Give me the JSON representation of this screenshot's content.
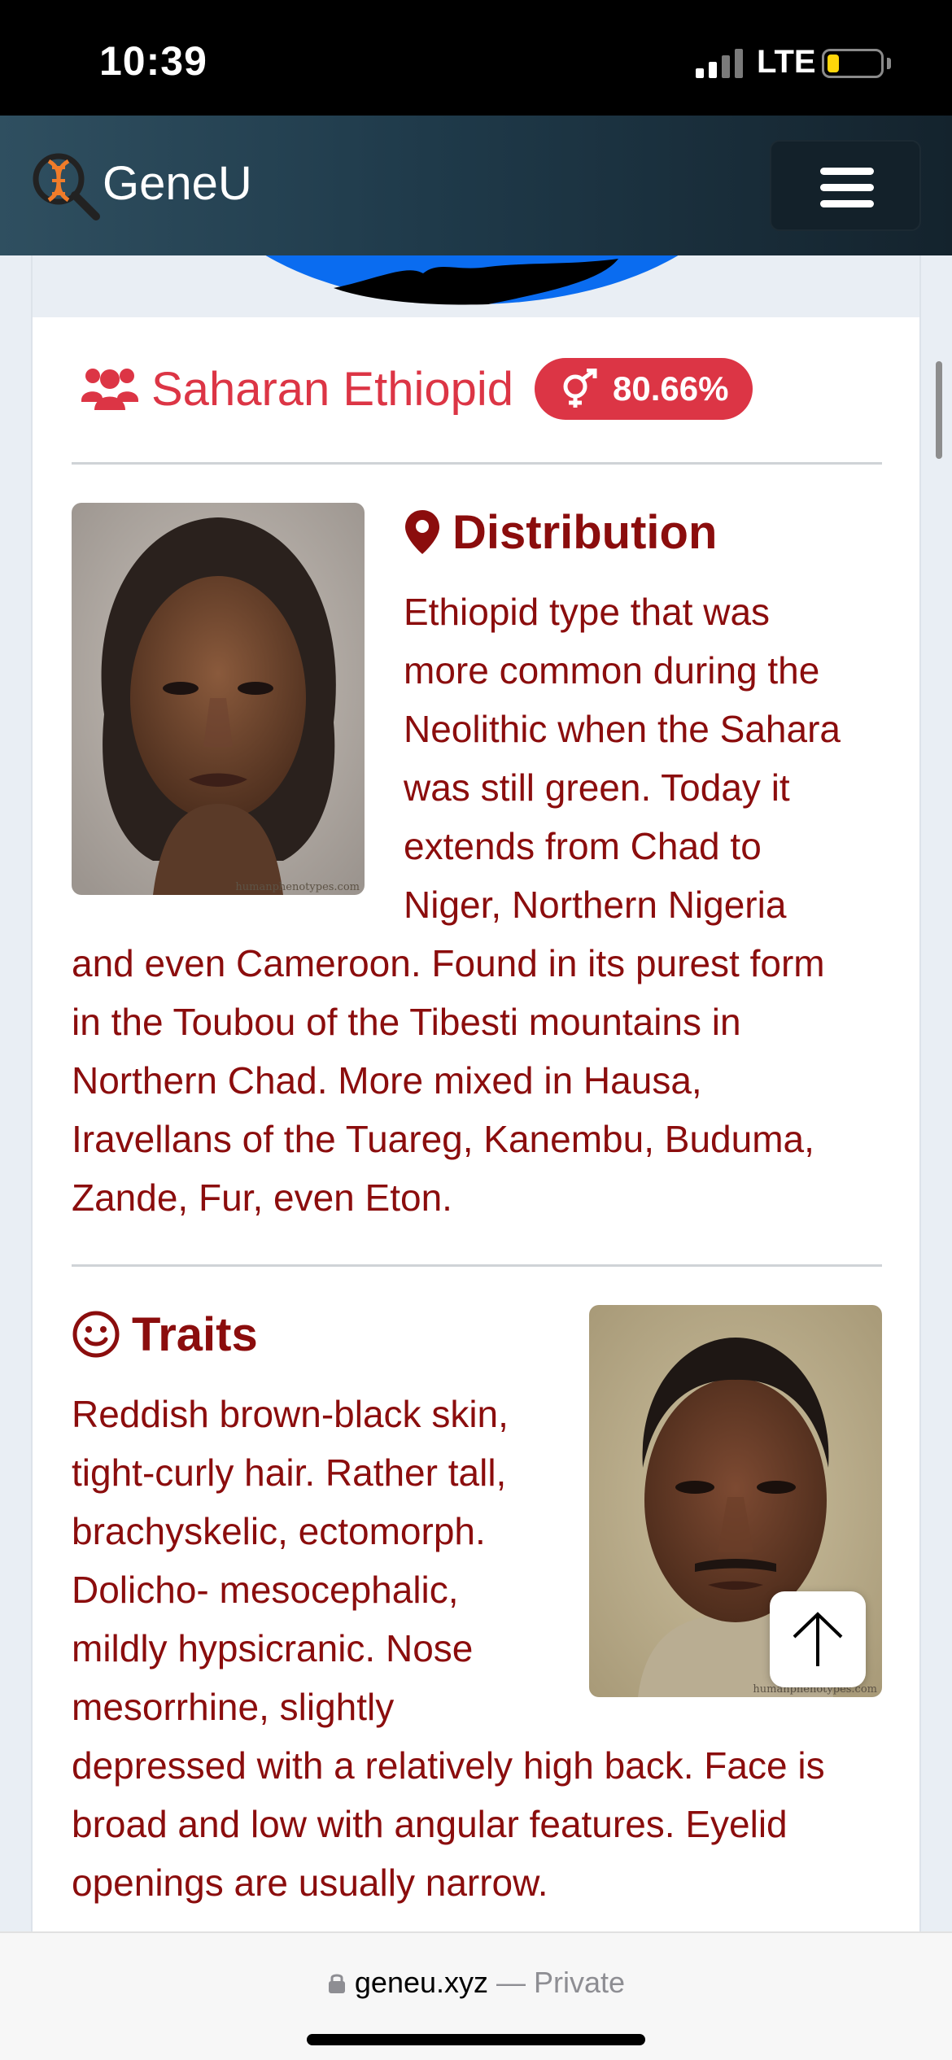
{
  "status_bar": {
    "time": "10:39",
    "network": "LTE"
  },
  "navbar": {
    "brand": "GeneU",
    "logo_icon": "dna-magnifier-icon",
    "menu_icon": "hamburger-icon"
  },
  "card": {
    "title": "Saharan Ethiopid",
    "title_icon": "users-icon",
    "badge_icon": "gender-icon",
    "badge_value": "80.66%",
    "distribution": {
      "heading": "Distribution",
      "icon": "map-marker-icon",
      "image_watermark": "humanphenotypes.com",
      "body": "Ethiopid type that was more common during the Neolithic when the Sahara was still green. Today it extends from Chad to Niger, Northern Nigeria and even Cameroon. Found in its purest form in the Toubou of the Tibesti mountains in Northern Chad. More mixed in Hausa, Iravellans of the Tuareg, Kanembu, Buduma, Zande, Fur, even Eton."
    },
    "traits": {
      "heading": "Traits",
      "icon": "smile-icon",
      "image_watermark": "humanphenotypes.com",
      "body": "Reddish brown-black skin, tight-curly hair. Rather tall, brachyskelic, ectomorph. Dolicho- mesocephalic, mildly hypsicranic. Nose mesorrhine, slightly depressed with a relatively high back. Face is broad and low with angular features. Eyelid openings are usually narrow."
    }
  },
  "scroll_top_icon": "arrow-up-icon",
  "browser": {
    "domain": "geneu.xyz",
    "separator": " — ",
    "mode": "Private",
    "lock_icon": "lock-icon"
  },
  "colors": {
    "accent_red": "#dc3545",
    "text_dark_red": "#8b0d0d",
    "navbar_start": "#2f4f60",
    "navbar_end": "#14232d"
  }
}
